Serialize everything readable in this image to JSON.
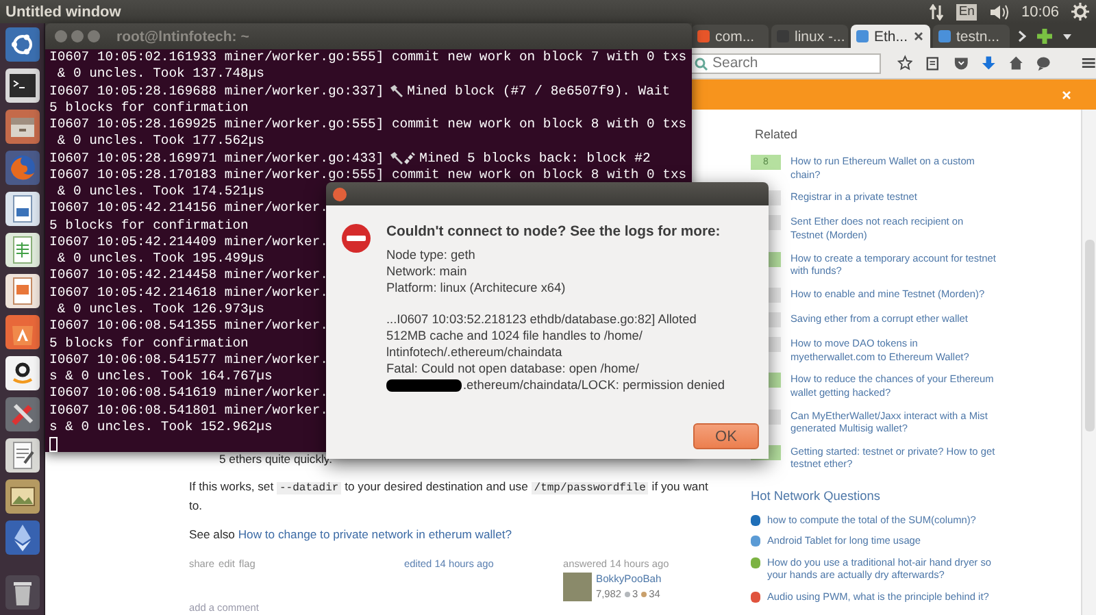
{
  "top_panel": {
    "title": "Untitled window",
    "keyboard": "En",
    "clock": "10:06"
  },
  "browser": {
    "tabs": [
      {
        "label": "com...",
        "selected": false
      },
      {
        "label": "linux -...",
        "selected": false
      },
      {
        "label": "Eth...",
        "selected": true
      },
      {
        "label": "testn...",
        "selected": false
      }
    ],
    "search": {
      "placeholder": "Search"
    },
    "related": {
      "heading": "Related",
      "items": [
        {
          "score": "8",
          "answered": true,
          "title": "How to run Ethereum Wallet on a custom chain?"
        },
        {
          "answered": false,
          "title": "Registrar in a private testnet"
        },
        {
          "answered": false,
          "title": "Sent Ether does not reach recipient on Testnet (Morden)"
        },
        {
          "answered": true,
          "title": "How to create a temporary account for testnet with funds?"
        },
        {
          "answered": false,
          "title": "How to enable and mine Testnet (Morden)?"
        },
        {
          "answered": false,
          "title": "Saving ether from a corrupt ether wallet"
        },
        {
          "answered": false,
          "title": "How to move DAO tokens in myetherwallet.com to Ethereum Wallet?"
        },
        {
          "answered": true,
          "title": "How to reduce the chances of your Ethereum wallet getting hacked?"
        },
        {
          "answered": false,
          "title": "Can MyEtherWallet/Jaxx interact with a Mist generated Multisig wallet?"
        },
        {
          "answered": true,
          "title": "Getting started: testnet or private? How to get testnet ether?"
        }
      ]
    },
    "hot": {
      "heading": "Hot Network Questions",
      "items": [
        {
          "title": "how to compute the total of the SUM(column)?",
          "color": "#1f6fb8"
        },
        {
          "title": "Android Tablet for long time usage",
          "color": "#5b9bd5"
        },
        {
          "title": "How do you use a traditional hot-air hand dryer so your hands are actually dry afterwards?",
          "color": "#7cb342"
        },
        {
          "title": "Audio using PWM, what is the principle behind it?",
          "color": "#e0533d"
        }
      ]
    },
    "answer": {
      "list_tail": "5 ethers quite quickly.",
      "paragraph": [
        {
          "text": "If this works, set ",
          "code": false
        },
        {
          "text": "--datadir",
          "code": true
        },
        {
          "text": " to your desired destination and use ",
          "code": false
        },
        {
          "text": "/tmp/passwordfile",
          "code": true
        },
        {
          "text": " if you want to.",
          "code": false
        }
      ],
      "see_also": {
        "prefix": "See also",
        "link": "How to change to private network in etherum wallet?"
      },
      "post_menu": [
        "share",
        "edit",
        "flag"
      ],
      "edited": "edited 14 hours ago",
      "answered": "answered 14 hours ago",
      "user": {
        "name": "BokkyPooBah",
        "reputation": "7,982",
        "silver": "3",
        "bronze": "34"
      },
      "add_comment": "add a comment"
    }
  },
  "terminal": {
    "title": "root@lntinfotech: ~",
    "lines": [
      {
        "kind": "text",
        "text": "I0607 10:05:02.161933 miner/worker.go:555] commit new work on block 7 with 0 txs"
      },
      {
        "kind": "text",
        "text": " & 0 uncles. Took 137.748µs"
      },
      {
        "kind": "mined",
        "prefix": "I0607 10:05:28.169688 miner/worker.go:337]",
        "text": "Mined block (#7 / 8e6507f9). Wait"
      },
      {
        "kind": "text",
        "text": "5 blocks for confirmation"
      },
      {
        "kind": "text",
        "text": "I0607 10:05:28.169925 miner/worker.go:555] commit new work on block 8 with 0 txs"
      },
      {
        "kind": "text",
        "text": " & 0 uncles. Took 177.562µs"
      },
      {
        "kind": "mined-back",
        "prefix": "I0607 10:05:28.169971 miner/worker.go:433]",
        "text": "Mined 5 blocks back: block #2"
      },
      {
        "kind": "text",
        "text": "I0607 10:05:28.170183 miner/worker.go:555] commit new work on block 8 with 0 txs"
      },
      {
        "kind": "text",
        "text": " & 0 uncles. Took 174.521µs"
      },
      {
        "kind": "text",
        "text": "I0607 10:05:42.214156 miner/worker."
      },
      {
        "kind": "text",
        "text": "5 blocks for confirmation"
      },
      {
        "kind": "text",
        "text": "I0607 10:05:42.214409 miner/worker."
      },
      {
        "kind": "text",
        "text": " & 0 uncles. Took 195.499µs"
      },
      {
        "kind": "text",
        "text": "I0607 10:05:42.214458 miner/worker."
      },
      {
        "kind": "text",
        "text": "I0607 10:05:42.214618 miner/worker."
      },
      {
        "kind": "text",
        "text": " & 0 uncles. Took 126.973µs"
      },
      {
        "kind": "text",
        "text": "I0607 10:06:08.541355 miner/worker."
      },
      {
        "kind": "text",
        "text": "5 blocks for confirmation"
      },
      {
        "kind": "text",
        "text": "I0607 10:06:08.541577 miner/worker."
      },
      {
        "kind": "text",
        "text": "s & 0 uncles. Took 164.767µs"
      },
      {
        "kind": "text",
        "text": "I0607 10:06:08.541619 miner/worker."
      },
      {
        "kind": "text",
        "text": "I0607 10:06:08.541801 miner/worker."
      },
      {
        "kind": "text",
        "text": "s & 0 uncles. Took 152.962µs"
      },
      {
        "kind": "cursor"
      }
    ]
  },
  "dialog": {
    "heading": "Couldn't connect to node? See the logs for more:",
    "details": [
      "Node type: geth",
      "Network: main",
      "Platform: linux (Architecure x64)"
    ],
    "log": [
      {
        "text": "...I0607 10:03:52.218123 ethdb/database.go:82] Alloted",
        "redacted": false
      },
      {
        "text": "512MB cache and 1024 file handles to /home/",
        "redacted": false
      },
      {
        "text": "lntinfotech/.ethereum/chaindata",
        "redacted": false
      },
      {
        "text": "Fatal: Could not open database: open /home/",
        "redacted": false
      },
      {
        "text": ".ethereum/chaindata/LOCK: permission denied",
        "redacted": true
      }
    ],
    "button": "OK"
  }
}
